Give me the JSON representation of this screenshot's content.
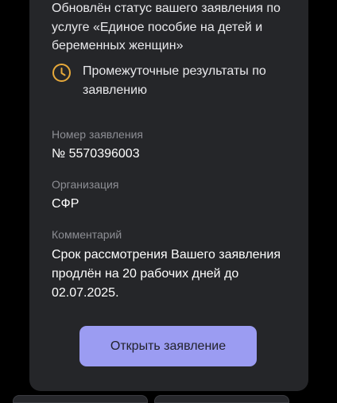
{
  "notification": {
    "message": "Обновлён статус вашего заявления по услуге «Единое пособие на детей и беременных женщин»",
    "status_text": "Промежуточные результаты по заявлению",
    "status_icon": "clock-icon",
    "status_icon_color": "#e7a93a"
  },
  "fields": {
    "number_label": "Номер заявления",
    "number_value": "№ 5570396003",
    "org_label": "Организация",
    "org_value": "СФР",
    "comment_label": "Комментарий",
    "comment_value": "Срок рассмотрения Вашего заявления продлён на 20 рабочих дней до 02.07.2025."
  },
  "actions": {
    "open_label": "Открыть заявление",
    "open_color": "#9b9cf2"
  }
}
